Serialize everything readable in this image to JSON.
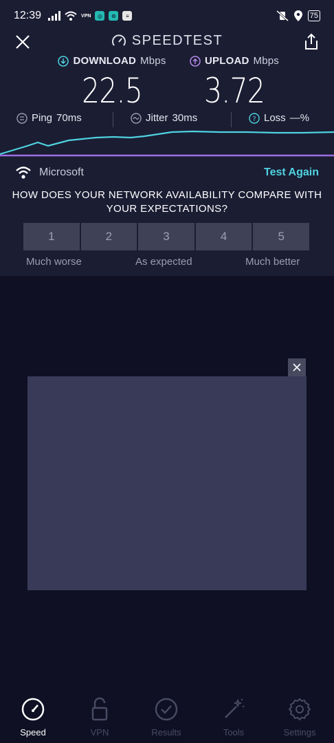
{
  "status_bar": {
    "time": "12:39",
    "vpn_badge": "VPN",
    "battery": "75"
  },
  "header": {
    "title": "SPEEDTEST"
  },
  "metrics": {
    "download": {
      "label": "DOWNLOAD",
      "unit": "Mbps",
      "value": "22.5",
      "color": "#4fd3e0"
    },
    "upload": {
      "label": "UPLOAD",
      "unit": "Mbps",
      "value": "3.72",
      "color": "#b58be8"
    }
  },
  "stats": {
    "ping": {
      "label": "Ping",
      "value": "70ms"
    },
    "jitter": {
      "label": "Jitter",
      "value": "30ms"
    },
    "loss": {
      "label": "Loss",
      "value": "—%"
    }
  },
  "provider": {
    "name": "Microsoft",
    "test_again": "Test Again"
  },
  "survey": {
    "question": "HOW DOES YOUR NETWORK AVAILABILITY COMPARE WITH YOUR EXPECTATIONS?",
    "options": [
      "1",
      "2",
      "3",
      "4",
      "5"
    ],
    "low_label": "Much worse",
    "mid_label": "As expected",
    "high_label": "Much better"
  },
  "nav": {
    "speed": "Speed",
    "vpn": "VPN",
    "results": "Results",
    "tools": "Tools",
    "settings": "Settings"
  },
  "icons": {
    "close": "close-icon",
    "share": "share-icon",
    "gauge": "gauge-icon",
    "download": "download-arrow-icon",
    "upload": "upload-arrow-icon",
    "wifi": "wifi-icon"
  },
  "colors": {
    "accent": "#4fd3e0",
    "upload": "#b58be8",
    "background": "#0f1023",
    "panel": "#1b1d33"
  }
}
